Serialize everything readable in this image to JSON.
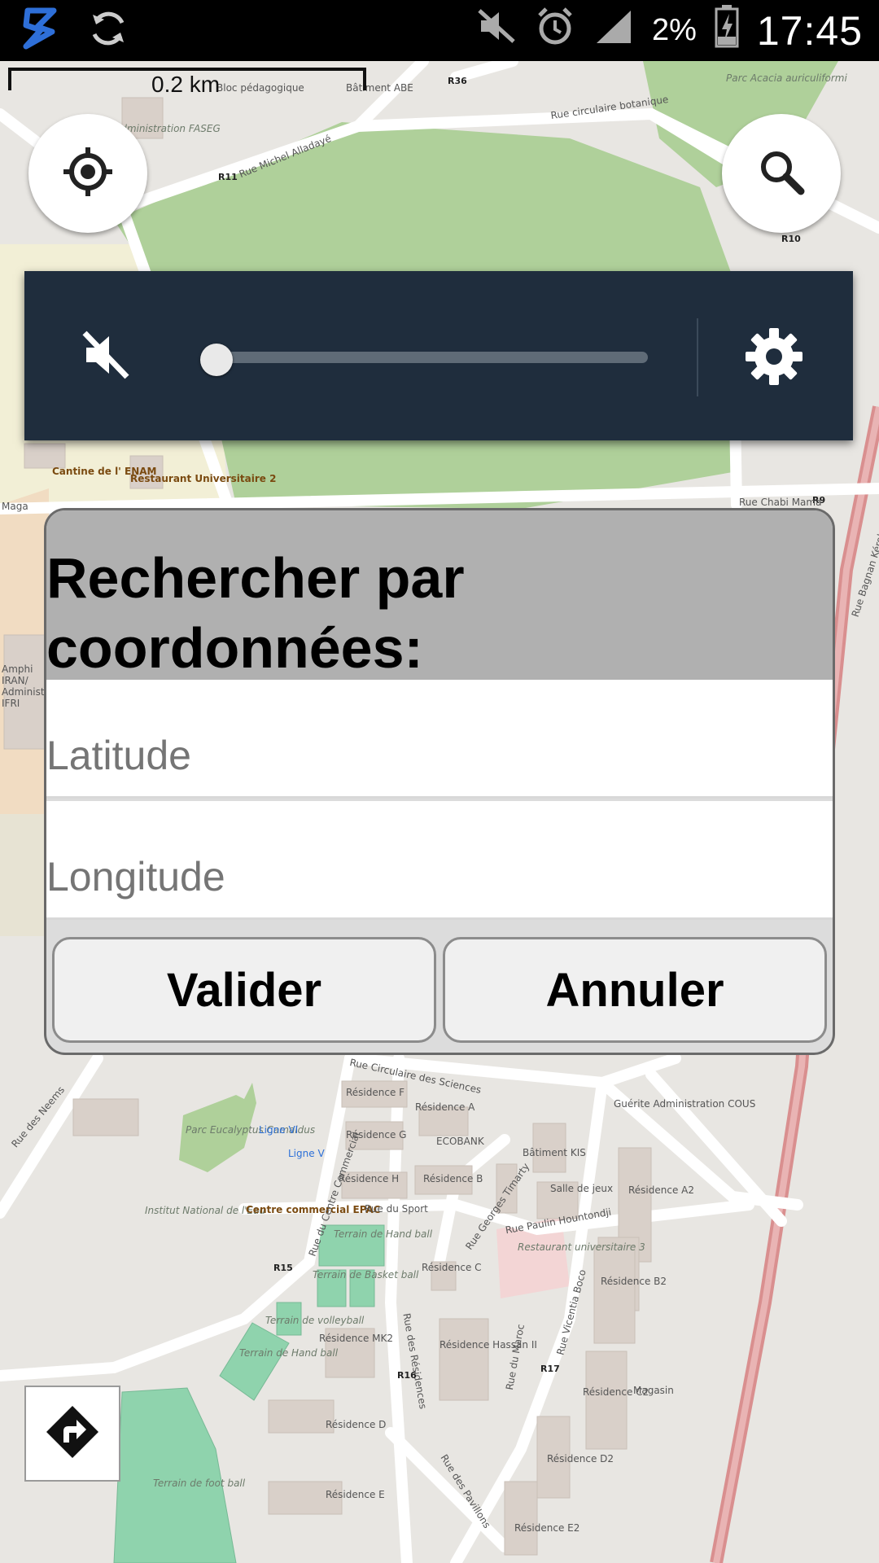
{
  "status_bar": {
    "icons": [
      "s-app-icon",
      "sync-icon",
      "mute-icon",
      "alarm-icon",
      "signal-icon",
      "battery-charging-icon"
    ],
    "battery_percent": "2%",
    "time": "17:45"
  },
  "map": {
    "scale_label": "0.2 km",
    "labels": {
      "parc_acacia": "Parc Acacia auriculiformi",
      "rue_botanique": "Rue circulaire botanique",
      "rue_michel": "Rue Michel Alladayé",
      "r11": "R11",
      "r36": "R36",
      "r10": "R10",
      "r9": "R9",
      "r15": "R15",
      "r16": "R16",
      "r17": "R17",
      "batiment_abe": "Bâtiment ABE",
      "bloc_pedagogique": "Bloc pédagogique",
      "administration_faseg": "Administration FASEG",
      "cantine_enam": "Cantine de l' ENAM",
      "restaurant_2": "Restaurant Universitaire 2",
      "maga": "Maga",
      "rue_chabi_mama": "Rue Chabi Mama",
      "rue_bagnan": "Rue Bagnan Kéroko",
      "amphi_iran": "Amphi IRAN/ Administration IFRI",
      "rue_circulaire_sciences": "Rue Circulaire des Sciences",
      "residence_f": "Résidence F",
      "residence_a": "Résidence A",
      "ecobank": "ECOBANK",
      "residence_g": "Résidence G",
      "residence_h": "Résidence H",
      "residence_b": "Résidence B",
      "residence_c": "Résidence C",
      "residence_mk2": "Résidence MK2",
      "residence_hassan": "Résidence Hassan II",
      "residence_d": "Résidence D",
      "residence_e": "Résidence E",
      "residence_a2": "Résidence A2",
      "residence_b2": "Résidence B2",
      "residence_c2": "Résidence C2",
      "residence_d2": "Résidence D2",
      "residence_e2": "Résidence E2",
      "batiment_kis": "Bâtiment KIS",
      "salle_jeux": "Salle de jeux",
      "guerite": "Guérite Administration COUS",
      "parc_eucalyptus": "Parc Eucalyptus Camaldus",
      "ligne_vi": "Ligne VI",
      "ligne_v": "Ligne V",
      "institut_eau": "Institut National de l'Eau",
      "centre_epac": "Centre commercial EPAC",
      "rue_du_sport": "Rue du Sport",
      "rue_georges": "Rue Georges Timarty",
      "rue_paulin": "Rue Paulin Hountondji",
      "restaurant_3": "Restaurant universitaire 3",
      "terrain_handball": "Terrain de Hand ball",
      "terrain_basket": "Terrain de Basket ball",
      "terrain_volley": "Terrain de volleyball",
      "terrain_handball_2": "Terrain de Hand ball",
      "terrain_football": "Terrain de foot ball",
      "rue_commercial": "Rue du Centre Commercial",
      "rue_residences": "Rue des Résidences",
      "rue_maroc": "Rue du Maroc",
      "rue_vicentia": "Rue Vicentia Boco",
      "rue_pavillons": "Rue des Pavillons",
      "magasin": "Magasin",
      "rue_neems": "Rue des Neems"
    }
  },
  "buttons": {
    "locate_icon": "my-location-icon",
    "search_icon": "search-icon",
    "route_icon": "directions-icon"
  },
  "audio_panel": {
    "mute_icon": "volume-muted-icon",
    "volume_level": 0,
    "settings_icon": "gear-icon"
  },
  "dialog": {
    "title": "Rechercher par coordonnées:",
    "latitude_placeholder": "Latitude",
    "longitude_placeholder": "Longitude",
    "validate_label": "Valider",
    "cancel_label": "Annuler"
  }
}
